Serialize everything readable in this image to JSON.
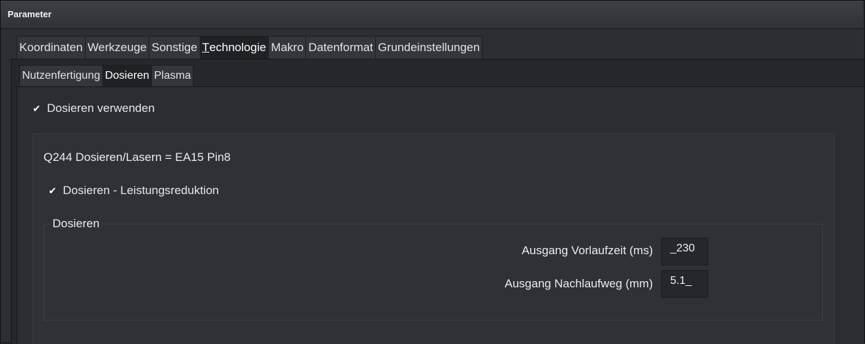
{
  "window": {
    "title": "Parameter"
  },
  "main_tabs": [
    {
      "label": "Koordinaten"
    },
    {
      "label": "Werkzeuge"
    },
    {
      "label": "Sonstige"
    },
    {
      "label_prefix": "T",
      "label_rest": "echnologie",
      "active": true
    },
    {
      "label": "Makro"
    },
    {
      "label": "Datenformat"
    },
    {
      "label": "Grundeinstellungen"
    }
  ],
  "sub_tabs": [
    {
      "label": "Nutzenfertigung"
    },
    {
      "label": "Dosieren",
      "active": true
    },
    {
      "label": "Plasma"
    }
  ],
  "dosieren": {
    "use_checkbox": {
      "label": "Dosieren verwenden",
      "checked": true
    },
    "info_text": "Q244 Dosieren/Lasern = EA15 Pin8",
    "reduction_checkbox": {
      "label": "Dosieren - Leistungsreduktion",
      "checked": true
    },
    "group": {
      "title": "Dosieren",
      "fields": [
        {
          "label": "Ausgang Vorlaufzeit (ms)",
          "value": "_230"
        },
        {
          "label": "Ausgang Nachlaufweg (mm)",
          "value": "5.1_"
        }
      ]
    }
  },
  "icons": {
    "checkmark": "✔"
  }
}
